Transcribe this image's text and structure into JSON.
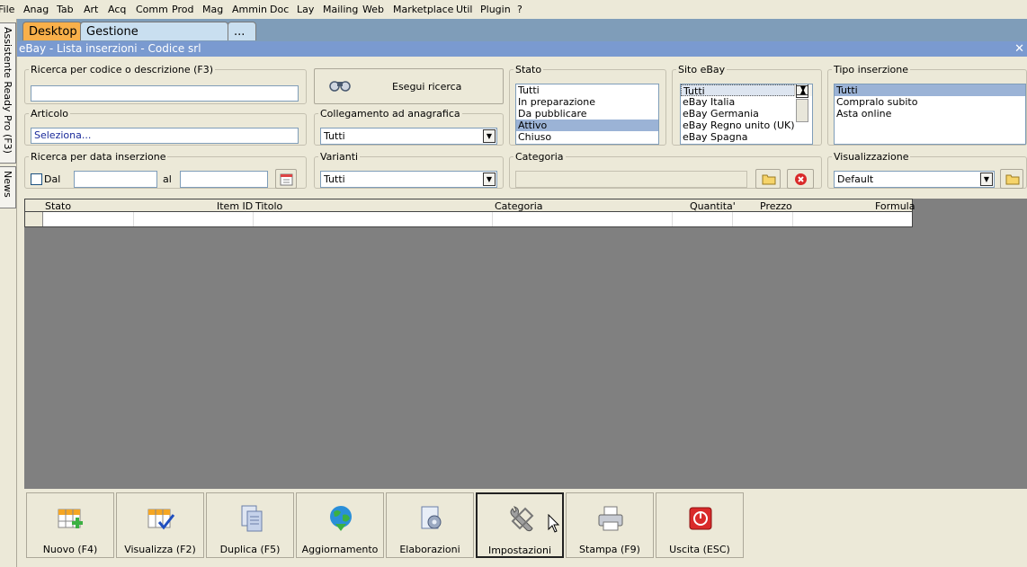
{
  "menu": [
    "File",
    "Anag",
    "Tab",
    "Art",
    "Acq",
    "Comm",
    "Prod",
    "Mag",
    "Ammin",
    "Doc",
    "Lay",
    "Mailing",
    "Web",
    "Marketplace",
    "Util",
    "Plugin",
    "?"
  ],
  "side_tabs": {
    "assistant": "Assistente Ready Pro (F3)",
    "news": "News"
  },
  "tabs": [
    "Desktop",
    "Gestione messaggistica",
    "..."
  ],
  "window_title": "eBay - Lista inserzioni - Codice srl",
  "search": {
    "label": "Ricerca per codice o descrizione (F3)",
    "value": ""
  },
  "search_button": "Esegui ricerca",
  "articolo": {
    "label": "Articolo",
    "value": "Seleziona..."
  },
  "collegamento": {
    "label": "Collegamento ad anagrafica",
    "value": "Tutti"
  },
  "data_inserzione": {
    "label": "Ricerca per data inserzione",
    "dal": "Dal",
    "al": "al",
    "dal_value": "",
    "al_value": ""
  },
  "varianti": {
    "label": "Varianti",
    "value": "Tutti"
  },
  "stato": {
    "label": "Stato",
    "options": [
      "Tutti",
      "In preparazione",
      "Da pubblicare",
      "Attivo",
      "Chiuso"
    ],
    "selected": "Attivo"
  },
  "sito": {
    "label": "Sito eBay",
    "options": [
      "Tutti",
      "eBay Italia",
      "eBay Germania",
      "eBay Regno unito (UK)",
      "eBay Spagna"
    ],
    "selected": "Tutti"
  },
  "tipo": {
    "label": "Tipo inserzione",
    "options": [
      "Tutti",
      "Compralo subito",
      "Asta online"
    ],
    "selected": "Tutti"
  },
  "categoria": {
    "label": "Categoria",
    "value": ""
  },
  "visualizzazione": {
    "label": "Visualizzazione",
    "value": "Default"
  },
  "columns": [
    "Stato",
    "Item ID",
    "Titolo",
    "Categoria",
    "Quantita'",
    "Prezzo",
    "Formula"
  ],
  "toolbar": [
    {
      "label": "Nuovo (F4)",
      "icon": "grid-add-icon"
    },
    {
      "label": "Visualizza (F2)",
      "icon": "grid-check-icon"
    },
    {
      "label": "Duplica (F5)",
      "icon": "copy-document-icon"
    },
    {
      "label": "Aggiornamento",
      "icon": "globe-update-icon"
    },
    {
      "label": "Elaborazioni",
      "icon": "gear-document-icon"
    },
    {
      "label": "Impostazioni",
      "icon": "wrench-icon"
    },
    {
      "label": "Stampa (F9)",
      "icon": "printer-icon"
    },
    {
      "label": "Uscita (ESC)",
      "icon": "power-exit-icon"
    }
  ],
  "colors": {
    "active_tab": "#f9b04a",
    "title_bar": "#7a9ad0",
    "selection": "#9bb3d6",
    "grid_bg": "#808080"
  }
}
